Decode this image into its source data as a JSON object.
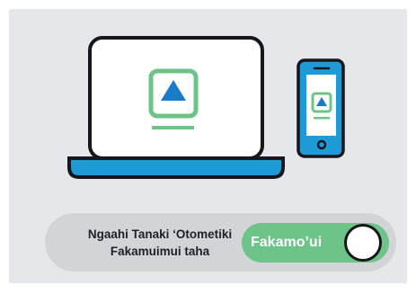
{
  "auto_update": {
    "label_lines": [
      "Ngaahi Tanaki ‘Otometiki",
      "Fakamuimui taha"
    ],
    "toggle_label": "Fakamo’ui",
    "enabled": true
  },
  "colors": {
    "card_background": "#e6e7ea",
    "accent_green": "#6cc489",
    "device_screen_blue": "#1e9bd7",
    "play_icon_blue": "#1a7cc8",
    "outline_dark": "#16161c"
  },
  "icons": [
    "laptop-icon",
    "smartphone-icon",
    "play-icon"
  ]
}
